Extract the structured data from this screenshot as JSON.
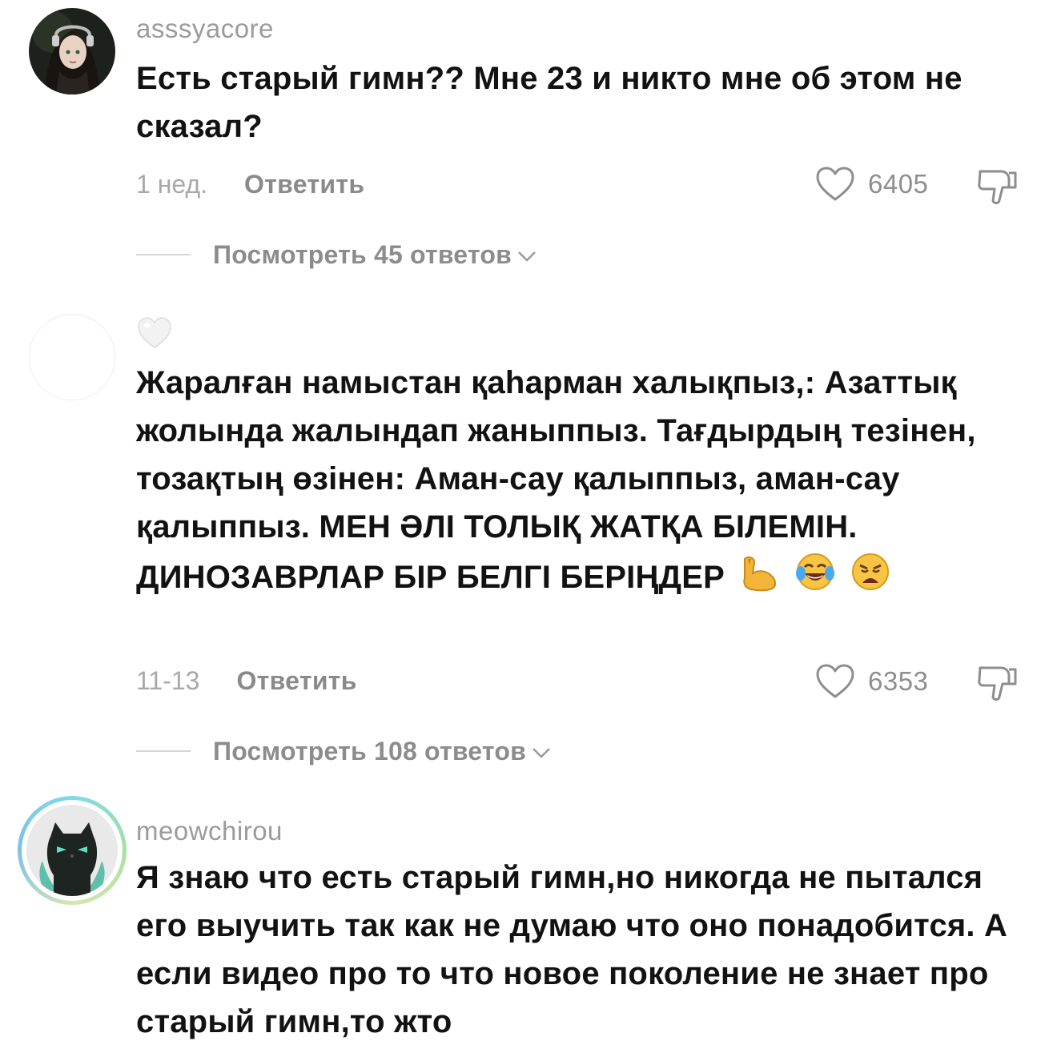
{
  "comments": [
    {
      "username": "asssyacore",
      "text": "Есть старый гимн?? Мне 23 и никто мне об этом не сказал?",
      "date": "1 нед.",
      "reply_label": "Ответить",
      "likes": "6405",
      "view_replies": "Посмотреть 45 ответов"
    },
    {
      "username": "",
      "text": "Жаралған намыстан қаһарман халықпыз,: Азаттық жолында жалындап жаныппыз. Тағдырдың тезінен, тозақтың өзінен: Аман-сау қалыппыз, аман-сау қалыппыз. МЕН ӘЛІ ТОЛЫҚ ЖАТҚА БІЛЕМІН. ДИНОЗАВРЛАР БІР БЕЛГІ БЕРІҢДЕР",
      "emojis": [
        "flexed-biceps",
        "face-with-tears-of-joy",
        "weary-face"
      ],
      "date": "11-13",
      "reply_label": "Ответить",
      "likes": "6353",
      "view_replies": "Посмотреть 108 ответов"
    },
    {
      "username": "meowchirou",
      "text": "Я знаю что есть старый гимн,но никогда не пытался его выучить так как не думаю что оно понадобится. А если видео про то что новое поколение не знает про старый гимн,то жто"
    }
  ],
  "icons": {
    "like": "heart-outline-icon",
    "dislike": "thumbs-down-icon",
    "expand": "chevron-down-icon",
    "username_placeholder": "white-heart-icon"
  }
}
